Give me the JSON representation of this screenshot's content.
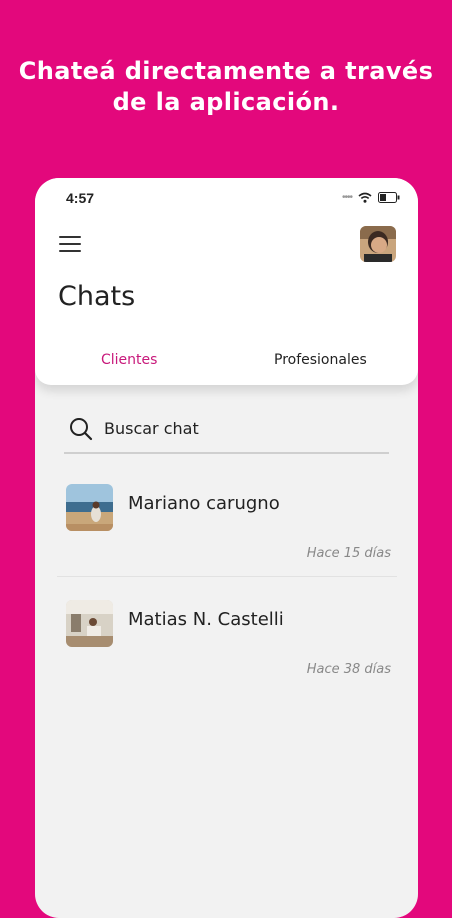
{
  "promo": {
    "line1": "Chateá directamente a través",
    "line2": "de la aplicación."
  },
  "status_bar": {
    "time": "4:57",
    "icons": [
      "signal-dots-icon",
      "wifi-icon",
      "battery-icon"
    ]
  },
  "header": {
    "menu_icon": "hamburger-menu-icon",
    "title": "Chats"
  },
  "tabs": [
    {
      "label": "Clientes",
      "active": true
    },
    {
      "label": "Profesionales",
      "active": false
    }
  ],
  "search": {
    "label": "Buscar chat"
  },
  "chats": [
    {
      "name": "Mariano carugno",
      "time": "Hace 15 días"
    },
    {
      "name": "Matias N. Castelli",
      "time": "Hace 38 días"
    }
  ],
  "colors": {
    "brand": "#e3087c",
    "active_tab": "#c8197b"
  }
}
